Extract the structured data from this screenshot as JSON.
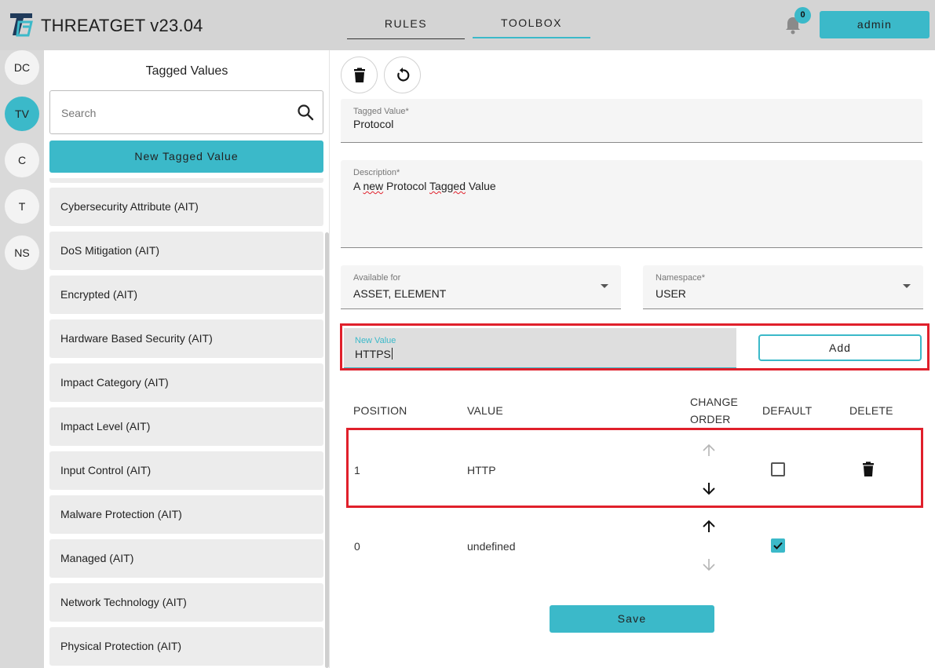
{
  "header": {
    "app_title": "THREATGET  v23.04",
    "tabs": [
      {
        "label": "RULES"
      },
      {
        "label": "TOOLBOX"
      }
    ],
    "notification_count": "0",
    "user_button": "admin"
  },
  "rail": {
    "items": [
      {
        "label": "DC"
      },
      {
        "label": "TV"
      },
      {
        "label": "C"
      },
      {
        "label": "T"
      },
      {
        "label": "NS"
      }
    ]
  },
  "panel": {
    "title": "Tagged Values",
    "search_placeholder": "Search",
    "new_button": "New Tagged Value",
    "items": [
      {
        "label": "Cybersecurity Attribute (AIT)"
      },
      {
        "label": "DoS Mitigation (AIT)"
      },
      {
        "label": "Encrypted (AIT)"
      },
      {
        "label": "Hardware Based Security (AIT)"
      },
      {
        "label": "Impact Category (AIT)"
      },
      {
        "label": "Impact Level (AIT)"
      },
      {
        "label": "Input Control (AIT)"
      },
      {
        "label": "Malware Protection (AIT)"
      },
      {
        "label": "Managed (AIT)"
      },
      {
        "label": "Network Technology (AIT)"
      },
      {
        "label": "Physical Protection (AIT)"
      }
    ]
  },
  "form": {
    "tagged_value": {
      "label": "Tagged Value*",
      "value": "Protocol"
    },
    "description": {
      "label": "Description*",
      "value_a": "A ",
      "value_b": "new",
      "value_c": " Protocol ",
      "value_d": "Tagged",
      "value_e": " Value"
    },
    "available_for": {
      "label": "Available for",
      "value": "ASSET, ELEMENT"
    },
    "namespace": {
      "label": "Namespace*",
      "value": "USER"
    },
    "new_value": {
      "label": "New Value",
      "value": "HTTPS"
    },
    "add_button": "Add"
  },
  "table": {
    "headers": {
      "position": "POSITION",
      "value": "VALUE",
      "change_order_1": "CHANGE",
      "change_order_2": "ORDER",
      "default": "DEFAULT",
      "delete": "DELETE"
    },
    "rows": [
      {
        "position": "1",
        "value": "HTTP",
        "default": false
      },
      {
        "position": "0",
        "value": "undefined",
        "default": true
      }
    ]
  },
  "save_button": "Save",
  "colors": {
    "accent": "#3bb9c9",
    "highlight": "#e0202b"
  }
}
